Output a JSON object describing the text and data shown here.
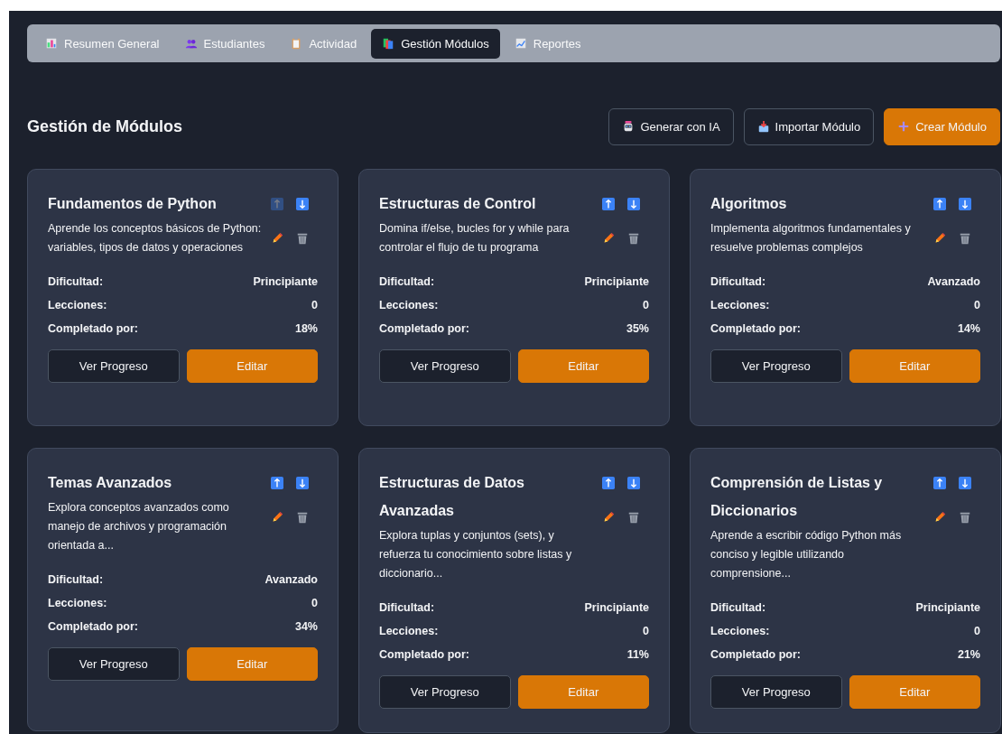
{
  "tabs": [
    {
      "label": "Resumen General",
      "selected": false
    },
    {
      "label": "Estudiantes",
      "selected": false
    },
    {
      "label": "Actividad",
      "selected": false
    },
    {
      "label": "Gestión Módulos",
      "selected": true
    },
    {
      "label": "Reportes",
      "selected": false
    }
  ],
  "page_title": "Gestión de Módulos",
  "actions": [
    {
      "label": "Generar con IA",
      "kind": "secondary"
    },
    {
      "label": "Importar Módulo",
      "kind": "secondary"
    },
    {
      "label": "Crear Módulo",
      "kind": "primary"
    }
  ],
  "modules": [
    {
      "title": "Fundamentos de Python",
      "description": "Aprende los conceptos básicos de Python: variables, tipos de datos y operaciones",
      "move_up_disabled": true,
      "stats": [
        {
          "label": "Dificultad:",
          "value": "Principiante"
        },
        {
          "label": "Lecciones:",
          "value": "0"
        },
        {
          "label": "Completado por:",
          "value": "18%"
        }
      ],
      "buttons": [
        "Ver Progreso",
        "Editar"
      ]
    },
    {
      "title": "Estructuras de Control",
      "description": "Domina if/else, bucles for y while para controlar el flujo de tu programa",
      "move_up_disabled": false,
      "stats": [
        {
          "label": "Dificultad:",
          "value": "Principiante"
        },
        {
          "label": "Lecciones:",
          "value": "0"
        },
        {
          "label": "Completado por:",
          "value": "35%"
        }
      ],
      "buttons": [
        "Ver Progreso",
        "Editar"
      ]
    },
    {
      "title": "Algoritmos",
      "description": "Implementa algoritmos fundamentales y resuelve problemas complejos",
      "move_up_disabled": false,
      "stats": [
        {
          "label": "Dificultad:",
          "value": "Avanzado"
        },
        {
          "label": "Lecciones:",
          "value": "0"
        },
        {
          "label": "Completado por:",
          "value": "14%"
        }
      ],
      "buttons": [
        "Ver Progreso",
        "Editar"
      ]
    },
    {
      "title": "Temas Avanzados",
      "description": "Explora conceptos avanzados como manejo de archivos y programación orientada a...",
      "move_up_disabled": false,
      "stats": [
        {
          "label": "Dificultad:",
          "value": "Avanzado"
        },
        {
          "label": "Lecciones:",
          "value": "0"
        },
        {
          "label": "Completado por:",
          "value": "34%"
        }
      ],
      "buttons": [
        "Ver Progreso",
        "Editar"
      ]
    },
    {
      "title": "Estructuras de Datos Avanzadas",
      "description": "Explora tuplas y conjuntos (sets), y refuerza tu conocimiento sobre listas y diccionario...",
      "move_up_disabled": false,
      "stats": [
        {
          "label": "Dificultad:",
          "value": "Principiante"
        },
        {
          "label": "Lecciones:",
          "value": "0"
        },
        {
          "label": "Completado por:",
          "value": "11%"
        }
      ],
      "buttons": [
        "Ver Progreso",
        "Editar"
      ]
    },
    {
      "title": "Comprensión de Listas y Diccionarios",
      "description": "Aprende a escribir código Python más conciso y legible utilizando comprensione...",
      "move_up_disabled": false,
      "stats": [
        {
          "label": "Dificultad:",
          "value": "Principiante"
        },
        {
          "label": "Lecciones:",
          "value": "0"
        },
        {
          "label": "Completado por:",
          "value": "21%"
        }
      ],
      "buttons": [
        "Ver Progreso",
        "Editar"
      ]
    }
  ]
}
